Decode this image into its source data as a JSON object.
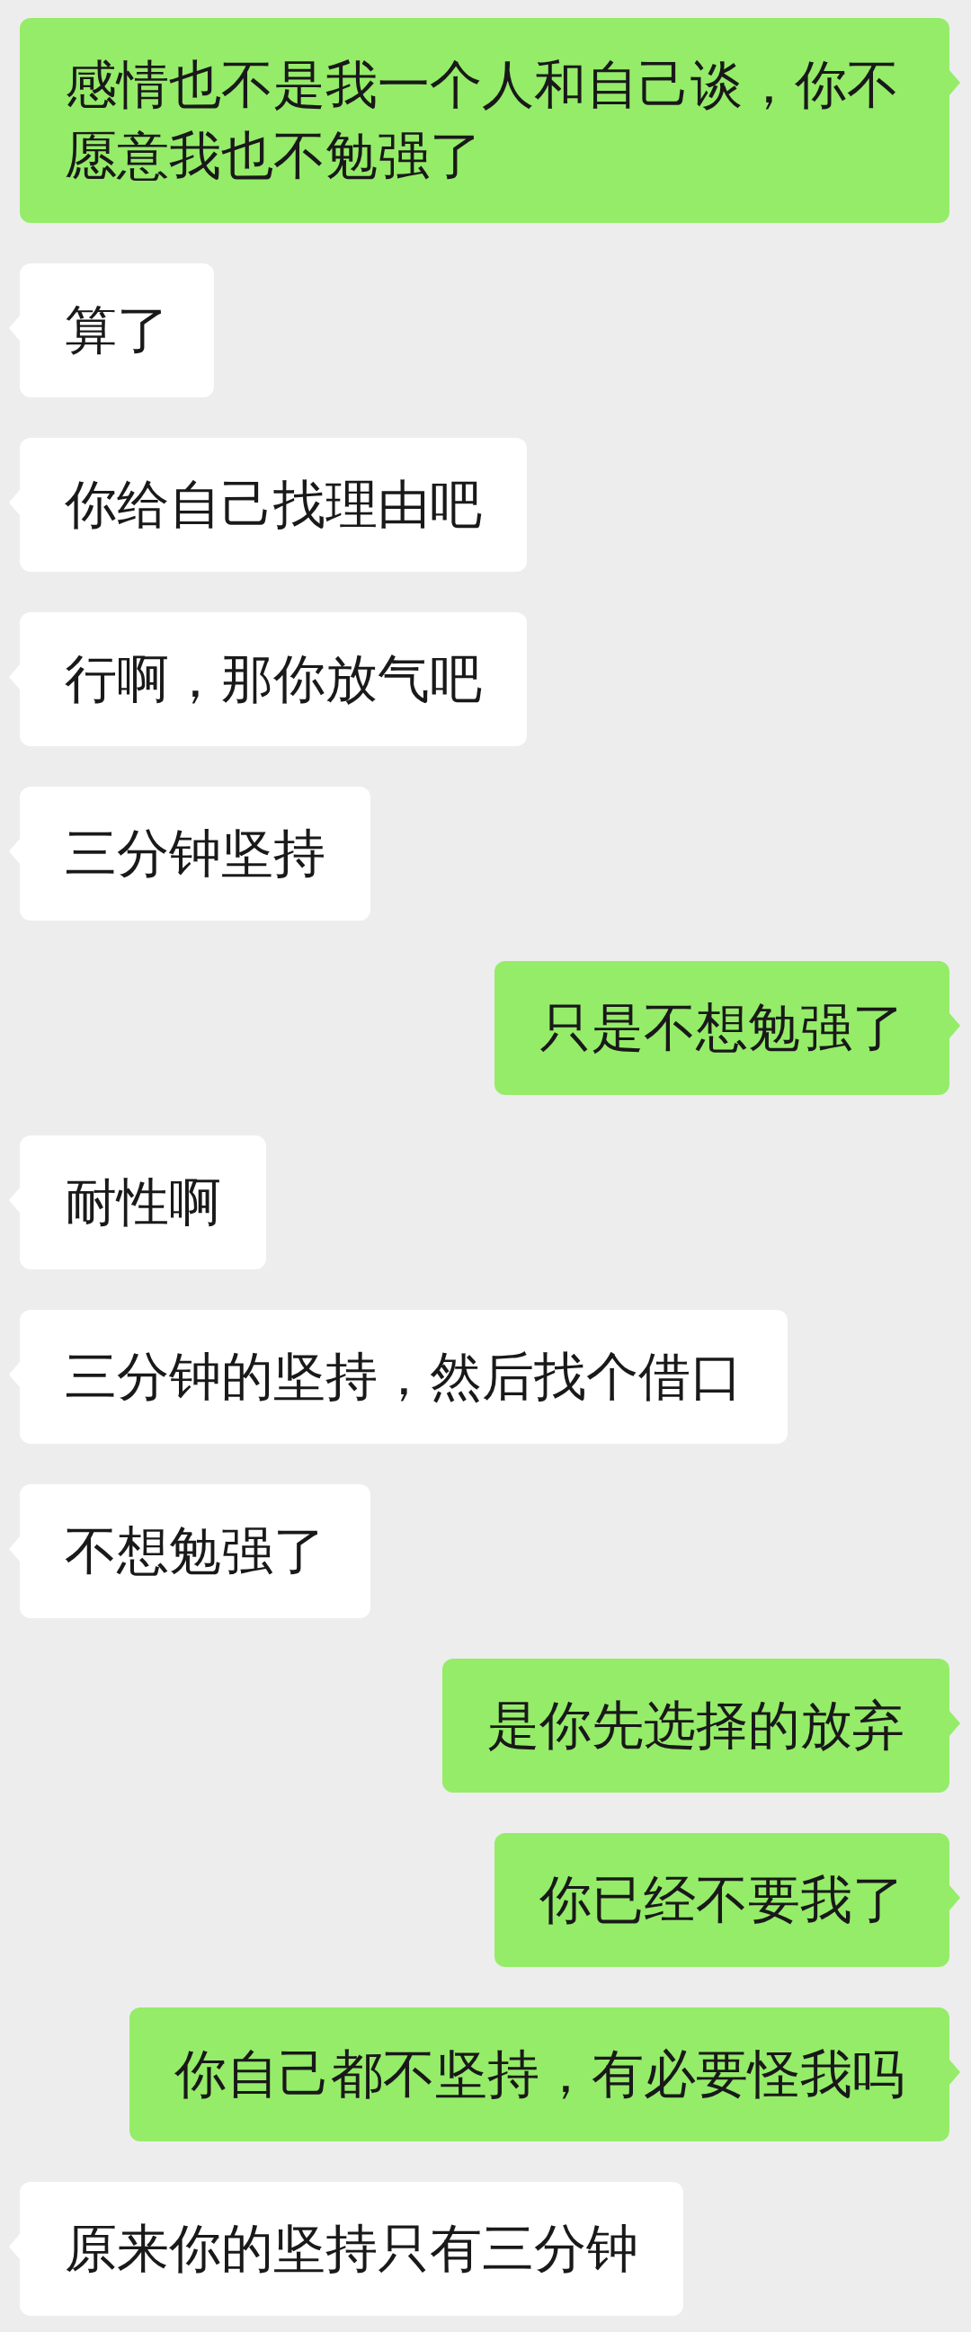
{
  "messages": [
    {
      "kind": "sent",
      "text": "感情也不是我一个人和自己谈，你不愿意我也不勉强了"
    },
    {
      "kind": "received",
      "text": "算了"
    },
    {
      "kind": "received",
      "text": "你给自己找理由吧"
    },
    {
      "kind": "received",
      "text": "行啊，那你放气吧"
    },
    {
      "kind": "received",
      "text": "三分钟坚持"
    },
    {
      "kind": "sent",
      "text": "只是不想勉强了"
    },
    {
      "kind": "received",
      "text": "耐性啊"
    },
    {
      "kind": "received",
      "text": "三分钟的坚持，然后找个借口"
    },
    {
      "kind": "received",
      "text": "不想勉强了"
    },
    {
      "kind": "sent",
      "text": "是你先选择的放弃"
    },
    {
      "kind": "sent",
      "text": "你已经不要我了"
    },
    {
      "kind": "sent",
      "text": "你自己都不坚持，有必要怪我吗"
    },
    {
      "kind": "received",
      "text": "原来你的坚持只有三分钟"
    }
  ]
}
